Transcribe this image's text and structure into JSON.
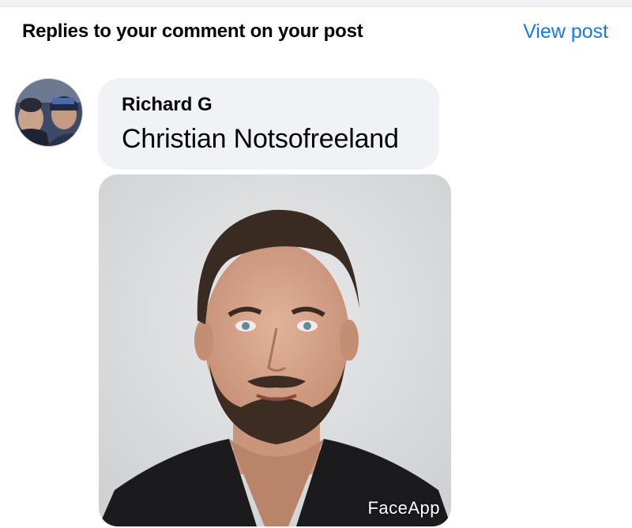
{
  "header": {
    "title": "Replies to your comment on your post",
    "view_post_label": "View post"
  },
  "comment": {
    "author": "Richard G",
    "text": "Christian Notsofreeland",
    "attachment": {
      "watermark": "FaceApp"
    }
  },
  "colors": {
    "link": "#1877f2",
    "bubble_bg": "#f0f2f5",
    "text": "#050505"
  }
}
